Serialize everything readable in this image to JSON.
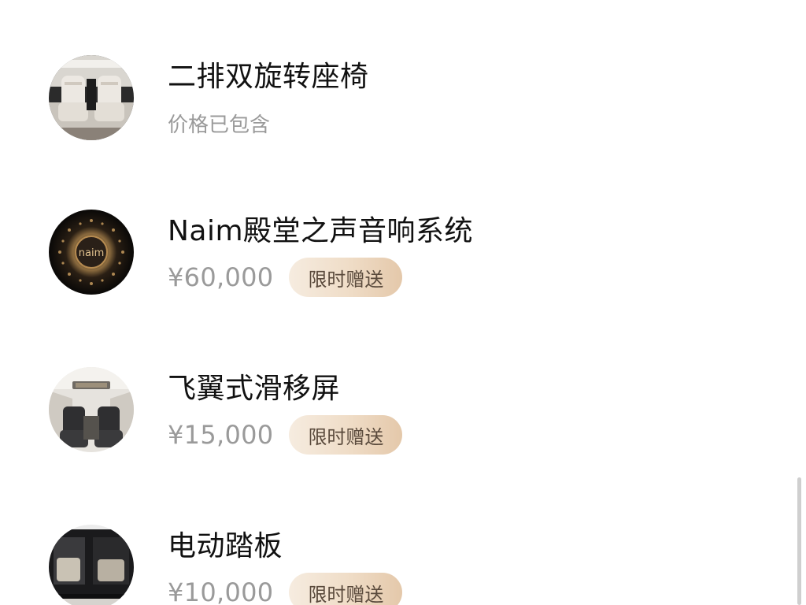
{
  "items": [
    {
      "title": "二排双旋转座椅",
      "price": "",
      "note": "价格已包含",
      "badge": "",
      "thumb_icon": "rotating-seats-image"
    },
    {
      "title": "Naim殿堂之声音响系统",
      "price": "¥60,000",
      "note": "",
      "badge": "限时赠送",
      "thumb_icon": "naim-speaker-image",
      "thumb_text": "naim"
    },
    {
      "title": "飞翼式滑移屏",
      "price": "¥15,000",
      "note": "",
      "badge": "限时赠送",
      "thumb_icon": "sliding-screen-image"
    },
    {
      "title": "电动踏板",
      "price": "¥10,000",
      "note": "",
      "badge": "限时赠送",
      "thumb_icon": "power-step-image"
    }
  ],
  "colors": {
    "title": "#111111",
    "price": "#9a9a9a",
    "badge_text": "#5a4a3c",
    "badge_bg_start": "#f6ece0",
    "badge_bg_end": "#e4c8aa"
  }
}
